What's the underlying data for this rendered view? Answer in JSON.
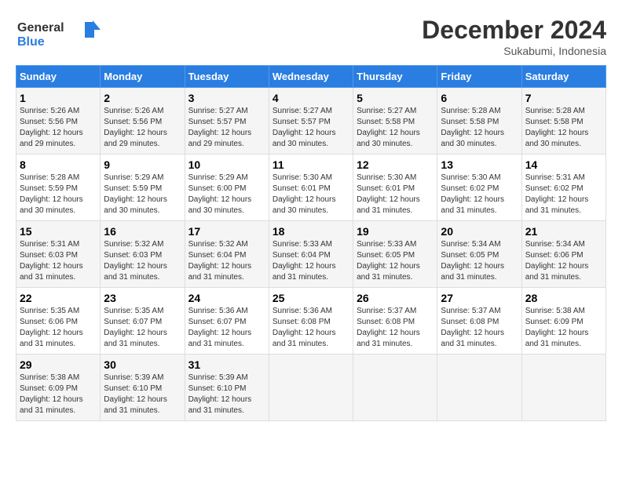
{
  "logo": {
    "line1": "General",
    "line2": "Blue"
  },
  "title": "December 2024",
  "location": "Sukabumi, Indonesia",
  "days_of_week": [
    "Sunday",
    "Monday",
    "Tuesday",
    "Wednesday",
    "Thursday",
    "Friday",
    "Saturday"
  ],
  "weeks": [
    [
      {
        "day": "1",
        "info": "Sunrise: 5:26 AM\nSunset: 5:56 PM\nDaylight: 12 hours\nand 29 minutes."
      },
      {
        "day": "2",
        "info": "Sunrise: 5:26 AM\nSunset: 5:56 PM\nDaylight: 12 hours\nand 29 minutes."
      },
      {
        "day": "3",
        "info": "Sunrise: 5:27 AM\nSunset: 5:57 PM\nDaylight: 12 hours\nand 29 minutes."
      },
      {
        "day": "4",
        "info": "Sunrise: 5:27 AM\nSunset: 5:57 PM\nDaylight: 12 hours\nand 30 minutes."
      },
      {
        "day": "5",
        "info": "Sunrise: 5:27 AM\nSunset: 5:58 PM\nDaylight: 12 hours\nand 30 minutes."
      },
      {
        "day": "6",
        "info": "Sunrise: 5:28 AM\nSunset: 5:58 PM\nDaylight: 12 hours\nand 30 minutes."
      },
      {
        "day": "7",
        "info": "Sunrise: 5:28 AM\nSunset: 5:58 PM\nDaylight: 12 hours\nand 30 minutes."
      }
    ],
    [
      {
        "day": "8",
        "info": "Sunrise: 5:28 AM\nSunset: 5:59 PM\nDaylight: 12 hours\nand 30 minutes."
      },
      {
        "day": "9",
        "info": "Sunrise: 5:29 AM\nSunset: 5:59 PM\nDaylight: 12 hours\nand 30 minutes."
      },
      {
        "day": "10",
        "info": "Sunrise: 5:29 AM\nSunset: 6:00 PM\nDaylight: 12 hours\nand 30 minutes."
      },
      {
        "day": "11",
        "info": "Sunrise: 5:30 AM\nSunset: 6:01 PM\nDaylight: 12 hours\nand 30 minutes."
      },
      {
        "day": "12",
        "info": "Sunrise: 5:30 AM\nSunset: 6:01 PM\nDaylight: 12 hours\nand 31 minutes."
      },
      {
        "day": "13",
        "info": "Sunrise: 5:30 AM\nSunset: 6:02 PM\nDaylight: 12 hours\nand 31 minutes."
      },
      {
        "day": "14",
        "info": "Sunrise: 5:31 AM\nSunset: 6:02 PM\nDaylight: 12 hours\nand 31 minutes."
      }
    ],
    [
      {
        "day": "15",
        "info": "Sunrise: 5:31 AM\nSunset: 6:03 PM\nDaylight: 12 hours\nand 31 minutes."
      },
      {
        "day": "16",
        "info": "Sunrise: 5:32 AM\nSunset: 6:03 PM\nDaylight: 12 hours\nand 31 minutes."
      },
      {
        "day": "17",
        "info": "Sunrise: 5:32 AM\nSunset: 6:04 PM\nDaylight: 12 hours\nand 31 minutes."
      },
      {
        "day": "18",
        "info": "Sunrise: 5:33 AM\nSunset: 6:04 PM\nDaylight: 12 hours\nand 31 minutes."
      },
      {
        "day": "19",
        "info": "Sunrise: 5:33 AM\nSunset: 6:05 PM\nDaylight: 12 hours\nand 31 minutes."
      },
      {
        "day": "20",
        "info": "Sunrise: 5:34 AM\nSunset: 6:05 PM\nDaylight: 12 hours\nand 31 minutes."
      },
      {
        "day": "21",
        "info": "Sunrise: 5:34 AM\nSunset: 6:06 PM\nDaylight: 12 hours\nand 31 minutes."
      }
    ],
    [
      {
        "day": "22",
        "info": "Sunrise: 5:35 AM\nSunset: 6:06 PM\nDaylight: 12 hours\nand 31 minutes."
      },
      {
        "day": "23",
        "info": "Sunrise: 5:35 AM\nSunset: 6:07 PM\nDaylight: 12 hours\nand 31 minutes."
      },
      {
        "day": "24",
        "info": "Sunrise: 5:36 AM\nSunset: 6:07 PM\nDaylight: 12 hours\nand 31 minutes."
      },
      {
        "day": "25",
        "info": "Sunrise: 5:36 AM\nSunset: 6:08 PM\nDaylight: 12 hours\nand 31 minutes."
      },
      {
        "day": "26",
        "info": "Sunrise: 5:37 AM\nSunset: 6:08 PM\nDaylight: 12 hours\nand 31 minutes."
      },
      {
        "day": "27",
        "info": "Sunrise: 5:37 AM\nSunset: 6:08 PM\nDaylight: 12 hours\nand 31 minutes."
      },
      {
        "day": "28",
        "info": "Sunrise: 5:38 AM\nSunset: 6:09 PM\nDaylight: 12 hours\nand 31 minutes."
      }
    ],
    [
      {
        "day": "29",
        "info": "Sunrise: 5:38 AM\nSunset: 6:09 PM\nDaylight: 12 hours\nand 31 minutes."
      },
      {
        "day": "30",
        "info": "Sunrise: 5:39 AM\nSunset: 6:10 PM\nDaylight: 12 hours\nand 31 minutes."
      },
      {
        "day": "31",
        "info": "Sunrise: 5:39 AM\nSunset: 6:10 PM\nDaylight: 12 hours\nand 31 minutes."
      },
      {
        "day": "",
        "info": ""
      },
      {
        "day": "",
        "info": ""
      },
      {
        "day": "",
        "info": ""
      },
      {
        "day": "",
        "info": ""
      }
    ]
  ]
}
